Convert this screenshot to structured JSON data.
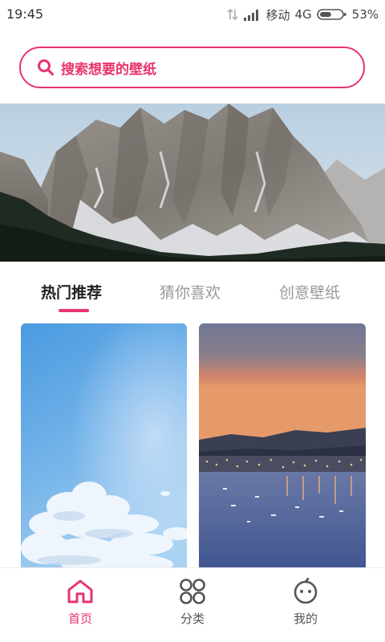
{
  "status_bar": {
    "time": "19:45",
    "carrier": "移动",
    "network": "4G",
    "battery": "53%",
    "battery_level": 0.53
  },
  "search": {
    "placeholder": "搜索想要的壁纸",
    "icon": "search-icon"
  },
  "tabs": [
    {
      "label": "热门推荐",
      "active": true
    },
    {
      "label": "猜你喜欢",
      "active": false
    },
    {
      "label": "创意壁纸",
      "active": false
    }
  ],
  "bottom_nav": [
    {
      "label": "首页",
      "icon": "home-icon",
      "active": true
    },
    {
      "label": "分类",
      "icon": "grid-icon",
      "active": false
    },
    {
      "label": "我的",
      "icon": "face-icon",
      "active": false
    }
  ],
  "colors": {
    "accent": "#e8346c",
    "inactive_text": "#999999"
  }
}
